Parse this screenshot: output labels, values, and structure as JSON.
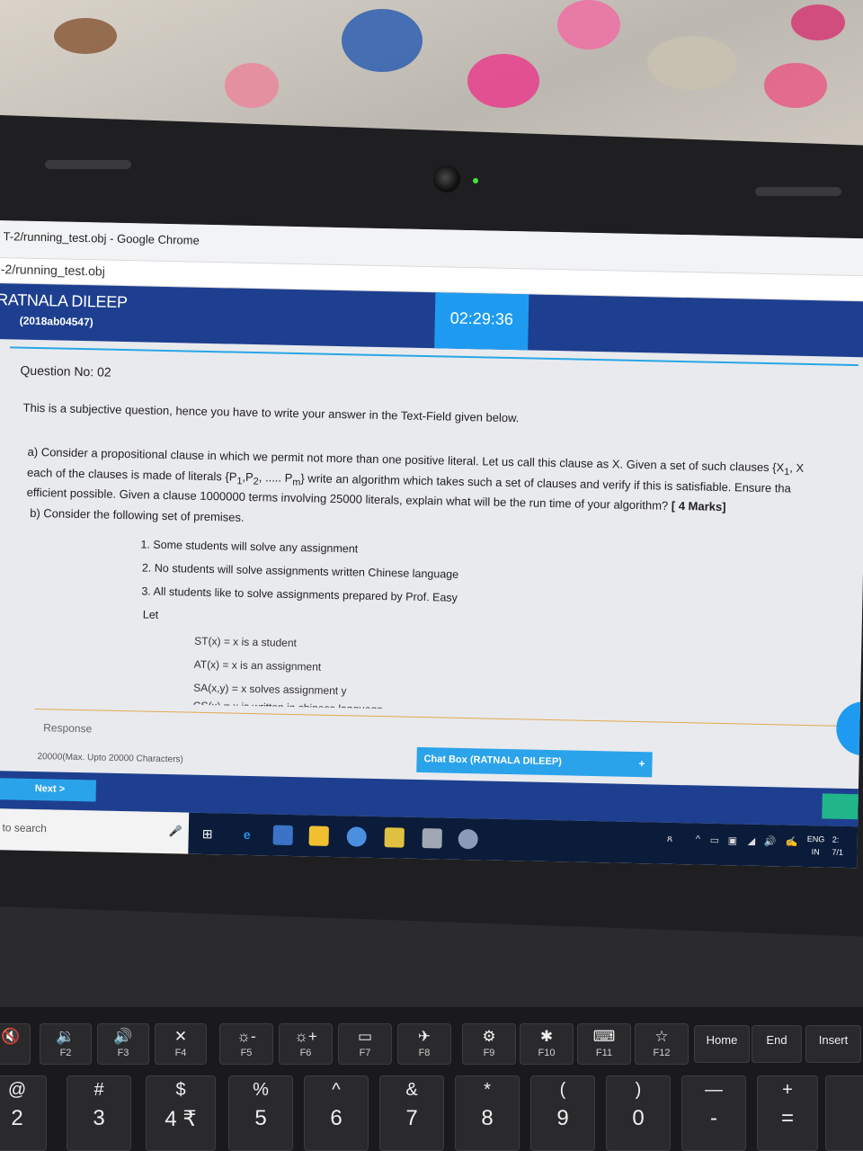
{
  "browser": {
    "window_title": "T-2/running_test.obj - Google Chrome",
    "address": "-2/running_test.obj"
  },
  "header": {
    "student_name": "RATNALA DILEEP",
    "student_id": "(2018ab04547)",
    "timer": "02:29:36"
  },
  "question": {
    "number_label": "Question No: 02",
    "intro": "This is a subjective question, hence you have to write your answer in the Text-Field given below.",
    "part_a_line1": "a) Consider a propositional clause in which we permit not more than one positive literal. Let us call this clause as X. Given a set of such clauses {X",
    "part_a_line2": "each of the clauses is made of literals {P",
    "part_a_line2_rest": ", ..... P",
    "part_a_line2_end": "} write an algorithm which takes such a set of clauses and verify if this is satisfiable. Ensure tha",
    "part_a_line3": "efficient possible. Given a clause 1000000 terms involving 25000 literals, explain what will be the run time of your algorithm?",
    "part_a_marks": "[ 4 Marks]",
    "part_b_intro": "b) Consider the following set of premises.",
    "premises": [
      "1. Some students will solve any assignment",
      "2. No students will solve assignments written Chinese language",
      "3. All students like to solve assignments prepared by Prof. Easy"
    ],
    "let_label": "Let",
    "definitions": [
      "ST(x) = x is a student",
      "AT(x) = x is an assignment",
      "SA(x,y) = x solves assignment y",
      "CS(x) = x is written in chinese language"
    ]
  },
  "response": {
    "label": "Response",
    "char_limit": "20000(Max. Upto 20000 Characters)"
  },
  "chat": {
    "label": "Chat Box (RATNALA DILEEP)",
    "toggle": "+"
  },
  "footer": {
    "next_label": "Next >"
  },
  "taskbar": {
    "search_placeholder": "ere to search",
    "lang_top": "ENG",
    "lang_bottom": "IN",
    "time_partial": "2:",
    "date_partial": "7/1"
  },
  "keyboard": {
    "fkeys": [
      {
        "icon": "🔇",
        "label": ""
      },
      {
        "icon": "🔉",
        "label": "F2"
      },
      {
        "icon": "🔊",
        "label": "F3"
      },
      {
        "icon": "✕",
        "label": "F4"
      },
      {
        "icon": "☼-",
        "label": "F5"
      },
      {
        "icon": "☼+",
        "label": "F6"
      },
      {
        "icon": "▭",
        "label": "F7"
      },
      {
        "icon": "✈",
        "label": "F8"
      },
      {
        "icon": "⚙",
        "label": "F9"
      },
      {
        "icon": "✱",
        "label": "F10"
      },
      {
        "icon": "⌨",
        "label": "F11"
      },
      {
        "icon": "☆",
        "label": "F12"
      }
    ],
    "nav_keys": [
      "Home",
      "End",
      "Insert"
    ],
    "number_keys": [
      {
        "sym": "@",
        "num": "2"
      },
      {
        "sym": "#",
        "num": "3"
      },
      {
        "sym": "$",
        "num": "4 ₹"
      },
      {
        "sym": "%",
        "num": "5"
      },
      {
        "sym": "^",
        "num": "6"
      },
      {
        "sym": "&",
        "num": "7"
      },
      {
        "sym": "*",
        "num": "8"
      },
      {
        "sym": "(",
        "num": "9"
      },
      {
        "sym": ")",
        "num": "0"
      },
      {
        "sym": "—",
        "num": "-"
      },
      {
        "sym": "+",
        "num": "="
      }
    ]
  },
  "colors": {
    "header_blue": "#1e3f8f",
    "accent_blue": "#1e9bf0",
    "accent_green": "#21b58a",
    "webcam_led": "#45e33b"
  }
}
